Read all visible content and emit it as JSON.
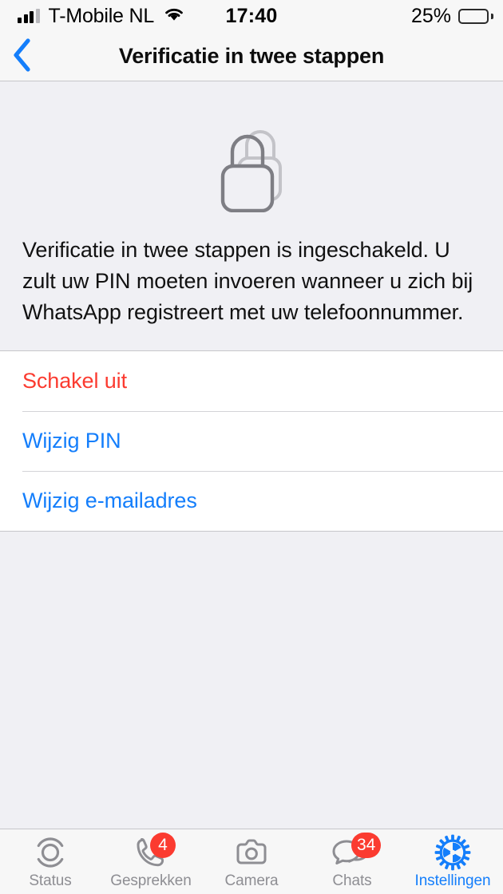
{
  "colors": {
    "accent_blue": "#147EFB",
    "destructive_red": "#FB3B30",
    "badge_red": "#FB3B30",
    "inactive_grey": "#8E8E93",
    "page_background": "#F0F0F4",
    "bar_background": "#F7F7F7",
    "row_background": "#FFFFFF",
    "separator": "#C6C6CA",
    "lock_front": "#7E7E84",
    "lock_back": "#C3C3C8"
  },
  "status_bar": {
    "carrier": "T-Mobile NL",
    "signal_icon": "signal-bars-icon",
    "signal_bars_filled": 3,
    "signal_bars_total": 4,
    "wifi_icon": "wifi-icon",
    "time": "17:40",
    "battery_percent": "25%",
    "battery_level": 25,
    "battery_icon": "battery-icon"
  },
  "nav_bar": {
    "back_icon": "chevron-left-icon",
    "title": "Verificatie in twee stappen"
  },
  "hero": {
    "icon": "two-locks-icon",
    "description": "Verificatie in twee stappen is ingeschakeld. U zult uw PIN moeten invoeren wanneer u zich bij WhatsApp registreert met uw telefoonnummer."
  },
  "actions": [
    {
      "label": "Schakel uit",
      "color": "#FB3B30",
      "name": "disable-two-step-row"
    },
    {
      "label": "Wijzig PIN",
      "color": "#147EFB",
      "name": "change-pin-row"
    },
    {
      "label": "Wijzig e-mailadres",
      "color": "#147EFB",
      "name": "change-email-row"
    }
  ],
  "tab_bar": {
    "tabs": [
      {
        "label": "Status",
        "icon": "status-rings-icon",
        "badge": null,
        "active": false
      },
      {
        "label": "Gesprekken",
        "icon": "phone-icon",
        "badge": "4",
        "active": false
      },
      {
        "label": "Camera",
        "icon": "camera-icon",
        "badge": null,
        "active": false
      },
      {
        "label": "Chats",
        "icon": "chat-bubbles-icon",
        "badge": "34",
        "active": false
      },
      {
        "label": "Instellingen",
        "icon": "gear-icon",
        "badge": null,
        "active": true
      }
    ]
  }
}
